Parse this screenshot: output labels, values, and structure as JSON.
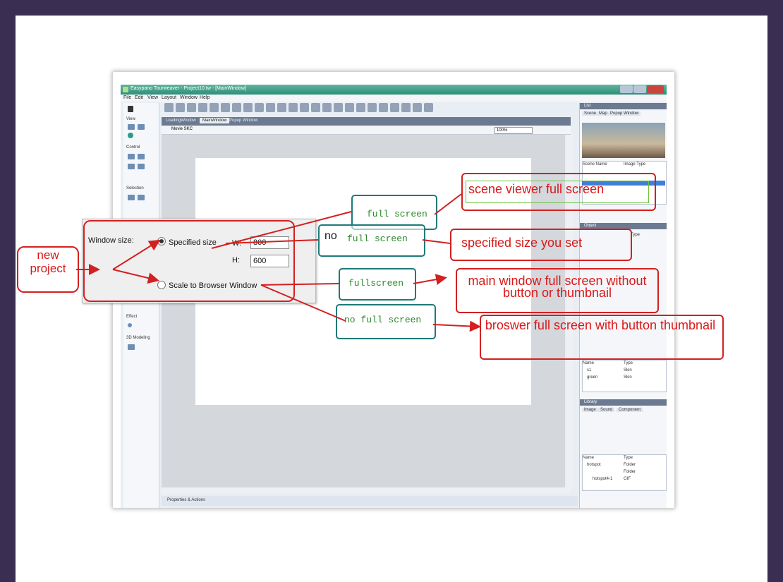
{
  "app": {
    "title": "Easypano Tourweaver - Project10.tw - [MainWindow]",
    "menu": [
      "File",
      "Edit",
      "View",
      "Layout",
      "Window",
      "Help"
    ],
    "tabs": [
      "LoadingWindow",
      "MainWindow",
      "Popup Window"
    ],
    "canvas_label": "Movie SKC",
    "zoom": "100%",
    "toolbox": [
      "View",
      "Control",
      "Selection",
      "Effect",
      "3D Modeling"
    ],
    "properties_bar": "Properties & Actions"
  },
  "right_panel": {
    "list_header": "List",
    "scene_tabs": [
      "Scene",
      "Map",
      "Popup Window"
    ],
    "scene_columns": [
      "Scene Name",
      "Image Type"
    ],
    "object_header": "Object",
    "object_type": "Type",
    "skin_columns": [
      "Name",
      "Type"
    ],
    "skin_rows": [
      [
        "s1",
        "Skin"
      ],
      [
        "green",
        "Skin"
      ]
    ],
    "library_header": "Library",
    "library_tabs": [
      "Image",
      "Sound",
      "Component"
    ],
    "library_columns": [
      "Name",
      "Type"
    ],
    "library_rows": [
      [
        "hotspot",
        "Folder"
      ],
      [
        "",
        "Folder"
      ],
      [
        "hotspot4-1",
        "GIF"
      ]
    ]
  },
  "dialog": {
    "window_size_label": "Window size:",
    "specified_size_label": "Specified size",
    "w_label": "W:",
    "w_value": "800",
    "h_label": "H:",
    "h_value": "600",
    "scale_label": "Scale to Browser Window"
  },
  "annotations": {
    "new_project": "new project",
    "full_screen": "full screen",
    "no": "no",
    "no_full_screen_1": "full screen",
    "fullscreen": "fullscreen",
    "no_full_screen_2": "no full screen",
    "scene_viewer": "scene viewer full screen",
    "specified_size": "specified size you set",
    "main_window": "main window full screen without button or thumbnail",
    "browser_full": "broswer full screen with button thumbnail"
  },
  "colors": {
    "frame": "#3a2f52",
    "annotation_red": "#d32020",
    "annotation_teal": "#1f7a7a",
    "mono_green": "#2a8a2a"
  }
}
